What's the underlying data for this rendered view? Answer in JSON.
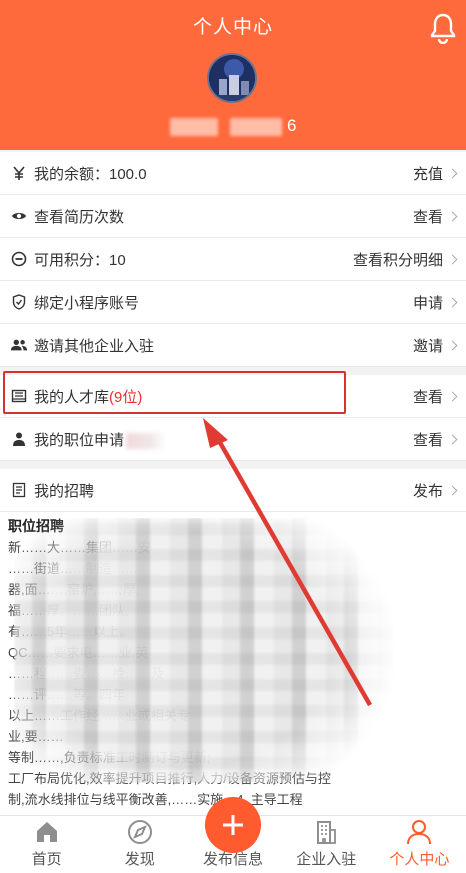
{
  "header": {
    "title": "个人中心",
    "username_suffix": "6",
    "accent": "#ff6a3d"
  },
  "menu": [
    {
      "icon": "yen-icon",
      "label": "我的余额：100.0",
      "action": "充值"
    },
    {
      "icon": "eye-icon",
      "label": "查看简历次数",
      "action": "查看"
    },
    {
      "icon": "minus-circle-icon",
      "label": "可用积分：10",
      "action": "查看积分明细"
    },
    {
      "icon": "shield-check-icon",
      "label": "绑定小程序账号",
      "action": "申请"
    },
    {
      "icon": "users-icon",
      "label": "邀请其他企业入驻",
      "action": "邀请"
    },
    {
      "icon": "book-icon",
      "label_prefix": "我的人才库",
      "label_count": "(9位)",
      "action": "查看"
    },
    {
      "icon": "person-icon",
      "label": "我的职位申请",
      "action": "查看"
    },
    {
      "icon": "document-icon",
      "label": "我的招聘",
      "action": "发布"
    }
  ],
  "recruitment": {
    "title": "职位招聘",
    "lines": [
      "新……大……集团……安",
      "……街道……制造……",
      "器,面……,窑炉,……厚,",
      "福……厚。……团队,",
      "有……5年……以上。",
      "QC……要求电……业,英",
      "……程……查……检……及",
      "……评……等。四年",
      "以上……工作经……业或相关专",
      "业,要……",
      "等制……,负责标准工时制订与更新;",
      "工厂布局优化,效率提升项目推行,人力/设备资源预估与控",
      "制,流水线排位与线平衡改善,……实施。4. 主导工程"
    ]
  },
  "tabbar": [
    {
      "icon": "home-icon",
      "label": "首页",
      "active": false
    },
    {
      "icon": "compass-icon",
      "label": "发现",
      "active": false
    },
    {
      "icon": "plus-icon",
      "label": "发布信息",
      "active": false
    },
    {
      "icon": "building-icon",
      "label": "企业入驻",
      "active": false
    },
    {
      "icon": "user-icon",
      "label": "个人中心",
      "active": true
    }
  ]
}
